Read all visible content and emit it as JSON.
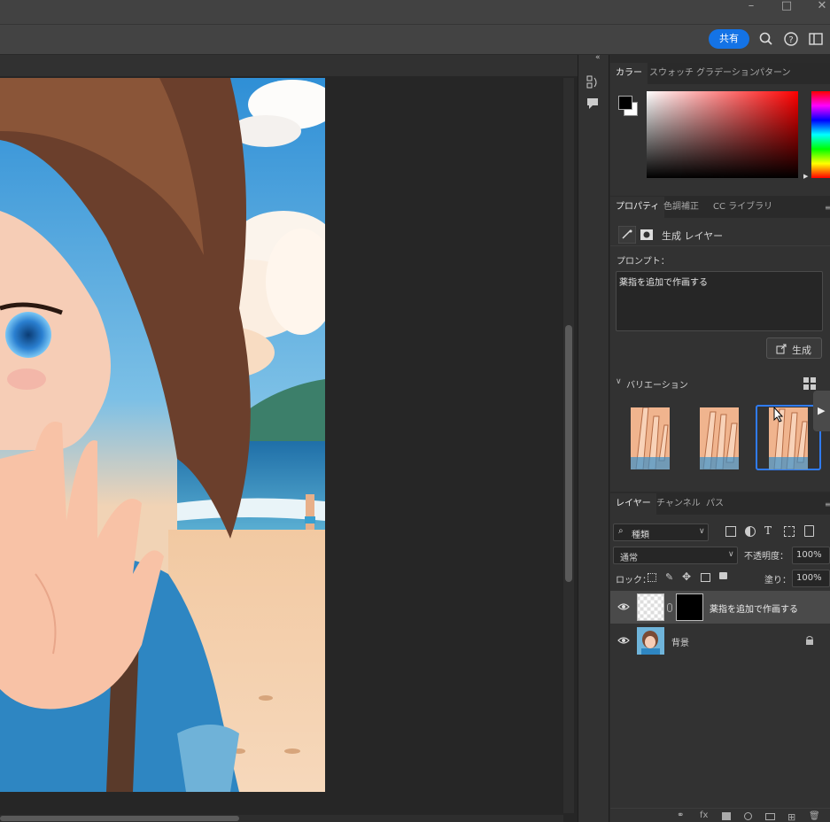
{
  "titlebar": {
    "minimize_icon": "minimize-icon",
    "maximize_icon": "maximize-icon",
    "close_icon": "close-icon"
  },
  "optbar": {
    "share_label": "共有",
    "icons": [
      "search-icon",
      "help-icon",
      "workspace-icon"
    ]
  },
  "color_panel": {
    "tabs": [
      "カラー",
      "スウォッチ",
      "グラデーション",
      "パターン"
    ],
    "active_tab": 0,
    "foreground": "#000000",
    "background": "#ffffff",
    "hue": "#ff0000"
  },
  "properties_panel": {
    "tabs": [
      "プロパティ",
      "色調補正",
      "CC ライブラリ"
    ],
    "active_tab": 0,
    "layer_type": "生成 レイヤー",
    "prompt_label": "プロンプト：",
    "prompt_value": "薬指を追加で作画する",
    "generate_label": "生成",
    "variations_label": "バリエーション",
    "selected_variation": 2
  },
  "layers_panel": {
    "tabs": [
      "レイヤー",
      "チャンネル",
      "パス"
    ],
    "active_tab": 0,
    "filter_label": "種類",
    "blend_mode": "通常",
    "opacity_label": "不透明度：",
    "opacity_value": "100%",
    "lock_label": "ロック：",
    "fill_label": "塗り：",
    "fill_value": "100%",
    "layers": [
      {
        "name": "薬指を追加で作画する",
        "selected": true
      },
      {
        "name": "背景",
        "selected": false,
        "locked": true
      }
    ],
    "footer_icons": [
      "link-icon",
      "fx-icon",
      "mask-icon",
      "adjustment-icon",
      "folder-icon",
      "new-layer-icon",
      "trash-icon"
    ]
  }
}
